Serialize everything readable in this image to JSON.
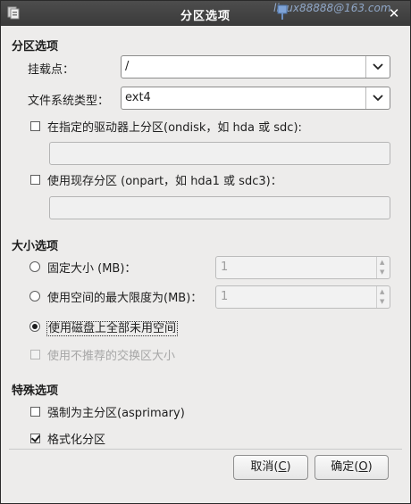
{
  "window": {
    "title": "分区选项",
    "watermark": "linux88888@163.com"
  },
  "partition_options": {
    "heading": "分区选项",
    "mount_point_label": "挂载点：",
    "mount_point_value": "/",
    "fs_type_label": "文件系统类型：",
    "fs_type_value": "ext4",
    "ondisk_label": "在指定的驱动器上分区(ondisk，如 hda 或 sdc):",
    "ondisk_checked": false,
    "ondisk_value": "",
    "onpart_label": "使用现存分区 (onpart，如 hda1 或 sdc3)：",
    "onpart_checked": false,
    "onpart_value": ""
  },
  "size_options": {
    "heading": "大小选项",
    "fixed_size_label": "固定大小 (MB)：",
    "fixed_size_value": "1",
    "max_size_label": "使用空间的最大限度为(MB)：",
    "max_size_value": "1",
    "fill_label": "使用磁盘上全部未用空间",
    "recommended_swap_label": "使用不推荐的交换区大小",
    "selected_option": "fill"
  },
  "special_options": {
    "heading": "特殊选项",
    "asprimary_label": "强制为主分区(asprimary)",
    "asprimary_checked": false,
    "format_label": "格式化分区",
    "format_checked": true
  },
  "buttons": {
    "cancel_label": "取消",
    "cancel_mnemonic": "C",
    "ok_label": "确定",
    "ok_mnemonic": "O"
  }
}
